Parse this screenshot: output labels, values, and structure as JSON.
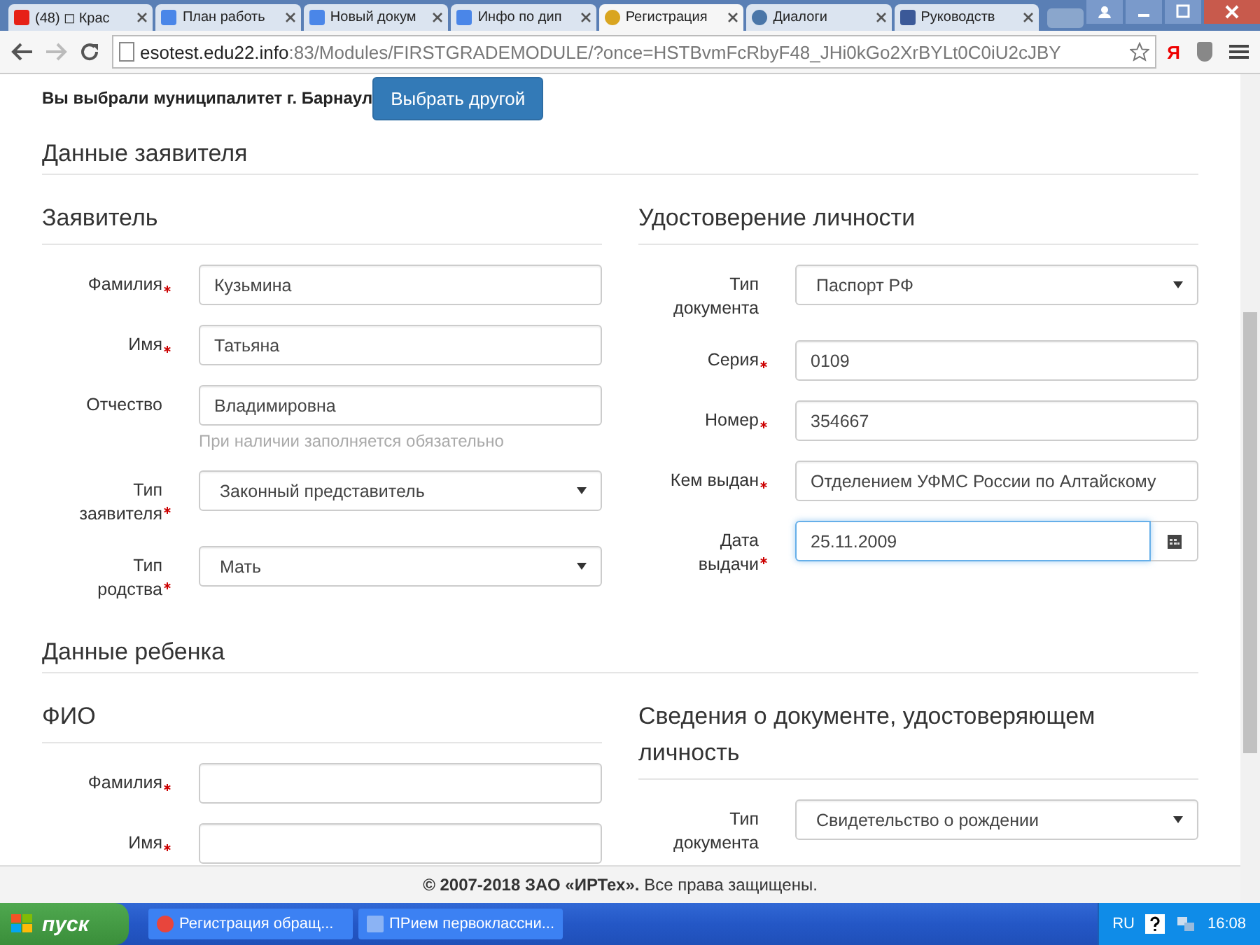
{
  "browser": {
    "tabs": [
      {
        "kind": "video",
        "title": "(48) ◻ Крас",
        "selected": false
      },
      {
        "kind": "doc",
        "title": "План работь",
        "selected": false
      },
      {
        "kind": "doc",
        "title": "Новый докум",
        "selected": false
      },
      {
        "kind": "doc",
        "title": "Инфо по дип",
        "selected": false
      },
      {
        "kind": "emblem",
        "title": "Регистрация",
        "selected": true
      },
      {
        "kind": "chat",
        "title": "Диалоги",
        "selected": false
      },
      {
        "kind": "shield",
        "title": "Руководств",
        "selected": false
      }
    ],
    "address": {
      "host": "esotest.edu22.info",
      "path": ":83/Modules/FIRSTGRADEMODULE/?once=HSTBvmFcRbyF48_JHi0kGo2XrBYLt0C0iU2cJBY"
    },
    "extension_label": "Я"
  },
  "page": {
    "municipality": {
      "text": "Вы выбрали муниципалитет г. Барнаул",
      "button": "Выбрать другой"
    },
    "sections": [
      {
        "title": "Данные заявителя",
        "columns": [
          {
            "title": "Заявитель",
            "fields": [
              {
                "kind": "text",
                "label": "Фамилия",
                "required": true,
                "value": "Кузьмина"
              },
              {
                "kind": "text",
                "label": "Имя",
                "required": true,
                "value": "Татьяна"
              },
              {
                "kind": "text",
                "label": "Отчество",
                "required": false,
                "value": "Владимировна",
                "hint": "При наличии заполняется обязательно"
              },
              {
                "kind": "select",
                "label": "Тип заявителя",
                "required": true,
                "value": "Законный представитель"
              },
              {
                "kind": "select",
                "label": "Тип родства",
                "required": true,
                "value": "Мать"
              }
            ]
          },
          {
            "title": "Удостоверение личности",
            "fields": [
              {
                "kind": "select",
                "label": "Тип документа",
                "required": false,
                "value": "Паспорт РФ"
              },
              {
                "kind": "text",
                "label": "Серия",
                "required": true,
                "value": "0109"
              },
              {
                "kind": "text",
                "label": "Номер",
                "required": true,
                "value": "354667"
              },
              {
                "kind": "text",
                "label": "Кем выдан",
                "required": true,
                "value": "Отделением УФМС России по Алтайскому"
              },
              {
                "kind": "date",
                "label": "Дата выдачи",
                "required": true,
                "value": "25.11.2009",
                "focused": true
              }
            ]
          }
        ]
      },
      {
        "title": "Данные ребенка",
        "columns": [
          {
            "title": "ФИО",
            "fields": [
              {
                "kind": "text",
                "label": "Фамилия",
                "required": true
              },
              {
                "kind": "text",
                "label": "Имя",
                "required": true
              }
            ]
          },
          {
            "title": "Сведения о документе, удостоверяющем личность",
            "fields": [
              {
                "kind": "select",
                "label": "Тип документа",
                "required": false,
                "value": "Свидетельство о рождении"
              }
            ]
          }
        ]
      }
    ],
    "footer": "**© 2007-2018 ЗАО «ИРТех».** Все права защищены."
  },
  "taskbar": {
    "start": "пуск",
    "tasks": [
      {
        "kind": "browser",
        "title": "Регистрация обращ..."
      },
      {
        "kind": "doc",
        "title": "ПРием первоклассни..."
      }
    ],
    "language": "RU",
    "time": "16:08"
  }
}
